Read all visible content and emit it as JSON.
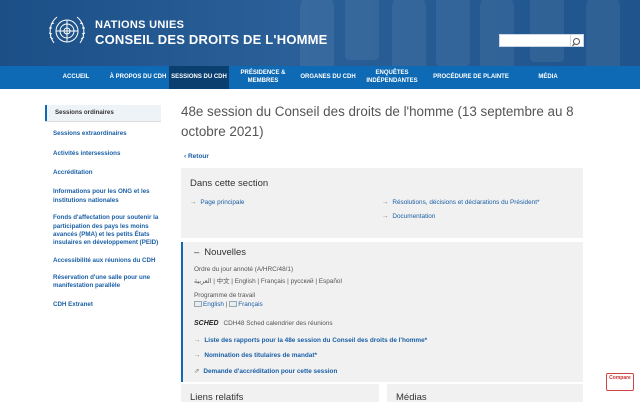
{
  "header": {
    "org_line1": "NATIONS UNIES",
    "org_line2": "CONSEIL DES DROITS DE L'HOMME",
    "search": {
      "placeholder": "",
      "value": ""
    },
    "logo_icon": "un-emblem-icon",
    "search_icon": "search-icon"
  },
  "nav": {
    "items": [
      {
        "label": "ACCUEIL"
      },
      {
        "label": "À PROPOS DU CDH"
      },
      {
        "label": "SESSIONS DU CDH"
      },
      {
        "label": "PRÉSIDENCE & MEMBRES"
      },
      {
        "label": "ORGANES DU CDH"
      },
      {
        "label": "ENQUÊTES INDÉPENDANTES"
      },
      {
        "label": "PROCÉDURE DE PLAINTE"
      },
      {
        "label": "MÉDIA"
      }
    ],
    "active_index": 2
  },
  "sidebar": {
    "items": [
      {
        "label": "Sessions ordinaires"
      },
      {
        "label": "Sessions extraordinaires"
      },
      {
        "label": "Activités intersessions"
      },
      {
        "label": "Accréditation"
      },
      {
        "label": "Informations pour les ONG et les institutions nationales"
      },
      {
        "label": "Fonds d'affectation pour soutenir la participation des pays les moins avancés (PMA) et les petits États insulaires en développement (PEID)"
      },
      {
        "label": "Accessibilité aux réunions du CDH"
      },
      {
        "label": "Réservation d'une salle pour une manifestation parallèle"
      },
      {
        "label": "CDH Extranet"
      }
    ]
  },
  "main": {
    "title": "48e session du Conseil des droits de l'homme (13 septembre au 8 octobre 2021)",
    "back_label": "Retour",
    "section": {
      "title": "Dans cette section",
      "links": [
        {
          "label": "Page principale"
        },
        {
          "label": "Résolutions, décisions et déclarations du Président*"
        },
        {
          "label": "Documentation"
        }
      ]
    },
    "news": {
      "title": "Nouvelles",
      "agenda_label": "Ordre du jour annoté (A/HRC/48/1)",
      "agenda_langs": [
        "العربية",
        "中文",
        "English",
        "Français",
        "русский",
        "Español"
      ],
      "programme_label": "Programme de travail",
      "programme_langs": [
        "English",
        "Français"
      ],
      "sched_logo": "SCHED",
      "sched_text": "CDH48 Sched calendrier des réunions",
      "links": [
        {
          "label": "Liste des rapports pour la 48e session du Conseil des droits de l'homme*"
        },
        {
          "label": "Nomination des titulaires de mandat*"
        },
        {
          "label": "Demande d'accréditation pour cette session"
        }
      ]
    },
    "bottom": [
      {
        "title": "Liens relatifs"
      },
      {
        "title": "Médias"
      }
    ]
  },
  "badge": {
    "label": "Compare"
  }
}
